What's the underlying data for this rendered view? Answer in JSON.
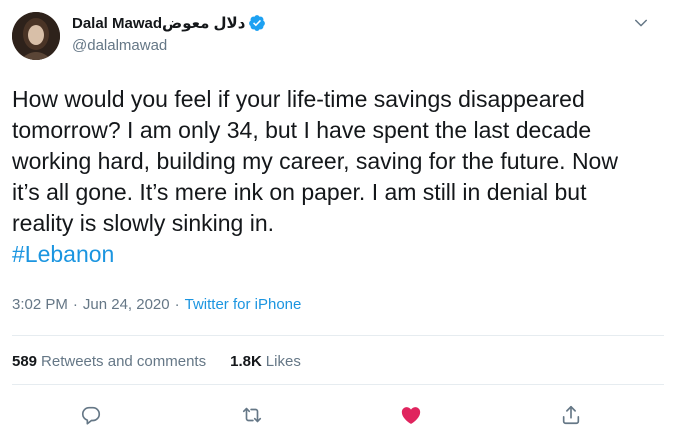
{
  "author": {
    "display_name": "Dalal Mawadدلال معوض",
    "handle": "@dalalmawad",
    "verified": true,
    "avatar_icon": "profile-photo"
  },
  "tweet": {
    "text": "How would you feel if your life-time savings disappeared tomorrow? I am only 34, but I have spent the last decade working hard, building my career, saving for the future. Now it’s all gone. It’s mere ink on paper. I am still in denial but reality is slowly sinking in.",
    "hashtag": "#Lebanon",
    "time": "3:02 PM",
    "date": "Jun 24, 2020",
    "separator": "·",
    "source": "Twitter for iPhone"
  },
  "stats": {
    "retweets_count": "589",
    "retweets_label": "Retweets and comments",
    "likes_count": "1.8K",
    "likes_label": "Likes"
  },
  "icons": {
    "caret": "chevron-down-icon",
    "reply": "reply-icon",
    "retweet": "retweet-icon",
    "like": "heart-icon",
    "share": "share-icon"
  },
  "colors": {
    "link": "#1b95e0",
    "like_active": "#e0245e",
    "icon_gray": "#657786",
    "verified": "#1da1f2"
  }
}
